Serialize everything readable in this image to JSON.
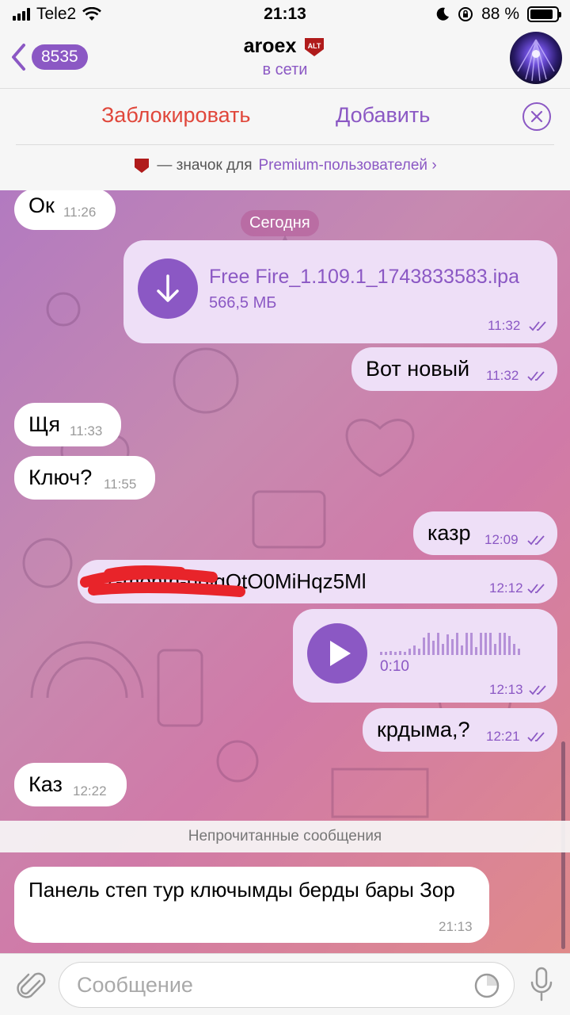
{
  "status_bar": {
    "carrier": "Tele2",
    "time": "21:13",
    "battery": "88 %"
  },
  "header": {
    "back_count": "8535",
    "title": "aroex",
    "badge_text": "ALT",
    "subtitle": "в сети"
  },
  "actions": {
    "block_label": "Заблокировать",
    "add_label": "Добавить",
    "premium_prefix": "— значок для",
    "premium_link": "Premium-пользователей"
  },
  "chat": {
    "date_label": "Сегодня",
    "unread_label": "Непрочитанные сообщения",
    "messages": [
      {
        "text": "Ок",
        "time": "11:26",
        "dir": "in"
      },
      {
        "file_name": "Free Fire_1.109.1_1743833583.ipa",
        "file_size": "566,5 МБ",
        "time": "11:32",
        "dir": "out"
      },
      {
        "text": "Вот новый",
        "time": "11:32",
        "dir": "out"
      },
      {
        "text": "Щя",
        "time": "11:33",
        "dir": "in"
      },
      {
        "text": "Ключ?",
        "time": "11:55",
        "dir": "in"
      },
      {
        "text": "казр",
        "time": "12:09",
        "dir": "out"
      },
      {
        "text": "...7-month-udlqQtO0MiHqz5Ml",
        "time": "12:12",
        "dir": "out"
      },
      {
        "voice_duration": "0:10",
        "time": "12:13",
        "dir": "out"
      },
      {
        "text": "крдыма,?",
        "time": "12:21",
        "dir": "out"
      },
      {
        "text": "Каз",
        "time": "12:22",
        "dir": "in"
      },
      {
        "text": "Панель степ тур ключымды берды бары Зор",
        "time": "21:13",
        "dir": "in"
      }
    ]
  },
  "composer": {
    "placeholder": "Сообщение"
  },
  "colors": {
    "accent": "#8b58c4",
    "block": "#e0473b",
    "outgoing_bubble": "#eedff7",
    "incoming_bubble": "#ffffff"
  }
}
